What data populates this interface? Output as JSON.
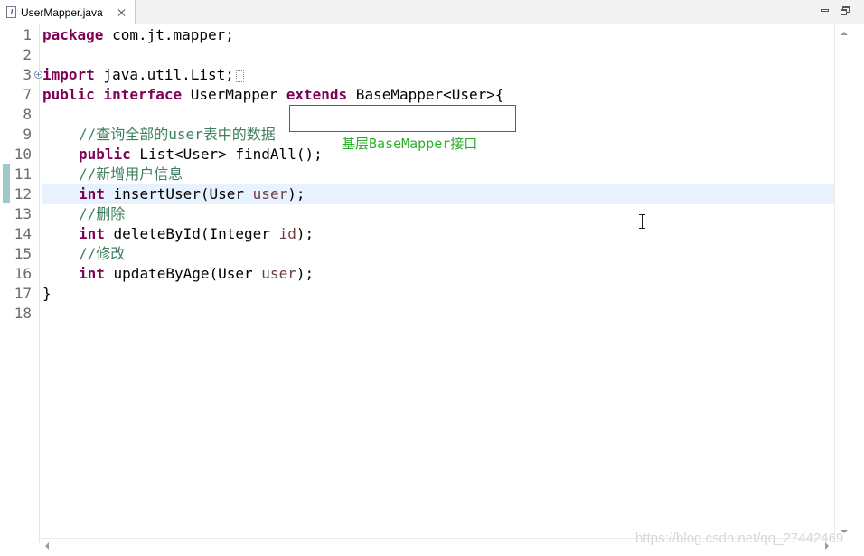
{
  "tab": {
    "title": "UserMapper.java",
    "file_icon": "J",
    "icon_name": "java-file-icon"
  },
  "editor": {
    "line_numbers": [
      "1",
      "2",
      "3",
      "7",
      "8",
      "9",
      "10",
      "11",
      "12",
      "13",
      "14",
      "15",
      "16",
      "17",
      "18"
    ],
    "current_line": "12",
    "changed_lines": [
      "11",
      "12"
    ],
    "folded_line": "3"
  },
  "code": {
    "l1": {
      "kw": "package",
      "rest": " com.jt.mapper;"
    },
    "l3": {
      "kw": "import",
      "rest": " java.util.List;"
    },
    "l7": {
      "kw1": "public",
      "kw2": "interface",
      "name": " UserMapper ",
      "kw3": "extends",
      "rest": " BaseMapper<User>{"
    },
    "l9": {
      "comment": "//查询全部的user表中的数据"
    },
    "l10": {
      "kw": "public",
      "rest": " List<User> findAll();"
    },
    "l11": {
      "comment": "//新增用户信息"
    },
    "l12": {
      "kw": "int",
      "mid": " insertUser(User ",
      "param": "user",
      "end": ");"
    },
    "l13": {
      "comment": "//删除"
    },
    "l14": {
      "kw": "int",
      "mid": " deleteById(Integer ",
      "param": "id",
      "end": ");"
    },
    "l15": {
      "comment": "//修改"
    },
    "l16": {
      "kw": "int",
      "mid": " updateByAge(User ",
      "param": "user",
      "end": ");"
    },
    "l17": {
      "rest": "}"
    }
  },
  "annotation": {
    "text": "基层BaseMapper接口",
    "box_color": "#e0262a",
    "text_color": "#2bb02b"
  },
  "watermark": "https://blog.csdn.net/qq_27442469",
  "colors": {
    "keyword": "#7f0055",
    "comment": "#3f7f5f",
    "parameter": "#6a3e3e",
    "current_line": "#e8f2fe"
  }
}
